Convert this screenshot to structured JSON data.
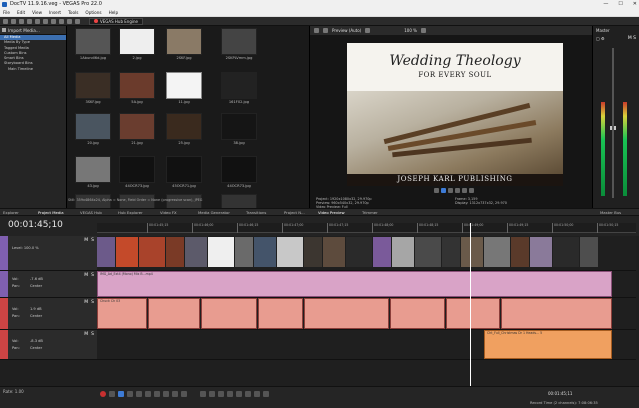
{
  "window": {
    "title": "DocTV 11.9.16.veg - VEGAS Pro 22.0",
    "controls": [
      "—",
      "☐",
      "✕"
    ]
  },
  "menu": [
    "File",
    "Edit",
    "View",
    "Insert",
    "Tools",
    "Options",
    "Help"
  ],
  "toolbar": {
    "hub_label": "VEGAS Hub Engine"
  },
  "explorer": {
    "import_label": "Import Media...",
    "tree": [
      "All Media",
      "Media By Type",
      "Tagged Media",
      "Custom Bins",
      "Smart Bins",
      "Storyboard Bins",
      "Main Timeline"
    ],
    "selected": 0
  },
  "media_grid": {
    "thumbs": [
      {
        "label": "1Abundl6d.jpg"
      },
      {
        "label": "2.jpg"
      },
      {
        "label": "2SKF.jpg"
      },
      {
        "label": "2SKPLVmm.jpg"
      },
      {
        "label": "3SKF.jpg"
      },
      {
        "label": "5A.jpg"
      },
      {
        "label": "11.jpg"
      },
      {
        "label": "161F02.jpg"
      },
      {
        "label": "20.jpg"
      },
      {
        "label": "21.jpg"
      },
      {
        "label": "25.jpg"
      },
      {
        "label": "38.jpg"
      },
      {
        "label": "43.jpg"
      },
      {
        "label": "44OCR73.jpg"
      },
      {
        "label": "45OCR71.jpg"
      },
      {
        "label": "44OCR73.jpg"
      },
      {
        "label": ""
      },
      {
        "label": ""
      },
      {
        "label": ""
      },
      {
        "label": ""
      }
    ],
    "selected": 6,
    "status": "Still: 359x4864x24, Alpha = None, Field Order = None (progressive scan), JPEG"
  },
  "preview": {
    "mode": "Preview (Auto)",
    "zoom": "100 %",
    "video_title": "Wedding Theology",
    "video_subtitle": "FOR EVERY SOUL",
    "video_publisher": "JOSEPH KARL PUBLISHING",
    "info_left": [
      "Project: 1920x1080x32, 29.970p",
      "Preview: 960x540x32, 29.970p",
      "Video Preview: Full"
    ],
    "info_right": [
      "Frame:    3,159",
      "Display:  1312x737x32, 29.970"
    ]
  },
  "master": {
    "label": "Master",
    "tab": "Master Bus"
  },
  "tabs": [
    "Explorer",
    "Project Media",
    "VEGAS Hub",
    "Hub Explorer",
    "Video FX",
    "Media Generator",
    "Transitions",
    "Project N...",
    "Video Preview",
    "Trimmer"
  ],
  "timeline": {
    "timecode": "00:01:45;10",
    "ruler": [
      "00:01:45;15",
      "00:01:46;00",
      "00:01:46;15",
      "00:01:47;00",
      "00:01:47;15",
      "00:01:48;00",
      "00:01:48;15",
      "00:01:49;00",
      "00:01:49;15",
      "00:01:50;00",
      "00:01:50;15",
      "00:01:51;00"
    ],
    "video_track": {
      "level": "Level: 100.0 %"
    },
    "audio_tracks": [
      {
        "vol": "-7.6 dB",
        "pan": "Center",
        "clip": "IMG_Ad_Ext4 (Mono) Mix B...mp4"
      },
      {
        "vol": "1.9 dB",
        "pan": "Center",
        "clip": "Chuck Ch 03"
      },
      {
        "vol": "-8.3 dB",
        "pan": "Center",
        "clip": "Cht_Full_Christmas Dr 1 Heads... 5"
      }
    ],
    "labels": {
      "vol": "Vol:",
      "pan": "Pan:",
      "m": "M",
      "s": "S"
    }
  },
  "bottom": {
    "rate": "Rate: 1.00",
    "time": "00:01:45;11",
    "record": "Record Time (2 channels): 7:08:06:35"
  }
}
